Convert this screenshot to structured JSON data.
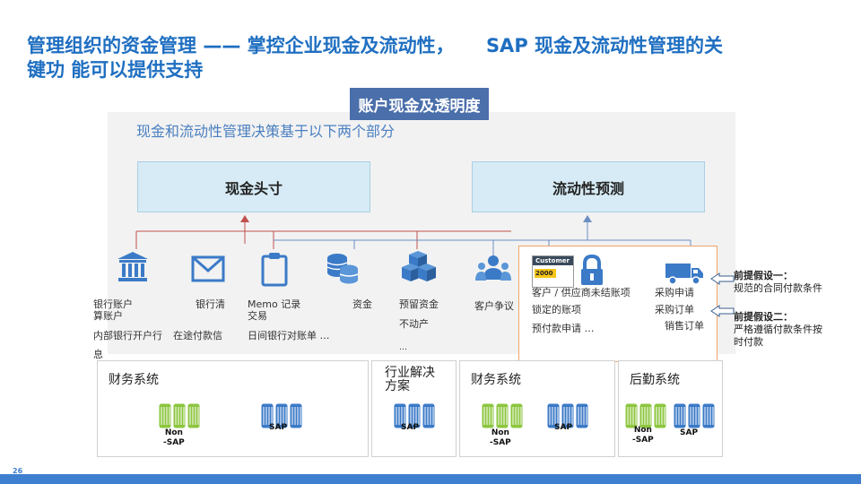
{
  "title": {
    "part1": "管理组织的资金管理",
    "part2": "—— 掌控企业现金及流动性，",
    "part3": "SAP  现金及流动性管理的关",
    "line2": "键功  能可以提供支持"
  },
  "header_box": "账户现金及透明度",
  "panel_caption": "现金和流动性管理决策基于以下两个部分",
  "boxes": {
    "cash_position": "现金头寸",
    "liquidity_forecast": "流动性预测"
  },
  "icons": {
    "bank": "bank-icon",
    "mail": "envelope-icon",
    "clipboard": "clipboard-icon",
    "coins": "coins-icon",
    "cubes": "cubes-icon",
    "people": "people-icon",
    "customer_card": "customer-card-icon",
    "lock": "lock-icon",
    "truck": "truck-icon",
    "arrow": "left-arrow-icon",
    "server": "server-icon"
  },
  "labels": {
    "bank_account": "银行账户",
    "calc_account": "算账户",
    "bank_clear": "银行清",
    "memo": "Memo  记录",
    "trade": "交易",
    "funds": "资金",
    "reserved_funds": "预留资金",
    "real_estate": "不动产",
    "dots_small": "…",
    "customer_dispute": "客户争议",
    "internal_bank": "内部银行开户行",
    "in_transit": "在途付款信",
    "info": "息",
    "daily_reconcile": "日间银行对账单  …",
    "customer_card_title": "Customer",
    "customer_card_num": "2000",
    "open_items": "客户 / 供应商未结账项",
    "locked_items": "锁定的账项",
    "prepayment": "预付款申请    …",
    "purchase_req": "采购申请",
    "purchase_order": "采购订单",
    "sales_order": "销售订单"
  },
  "assumptions": {
    "a1_title": "前提假设一：",
    "a1_text": "规范的合同付款条件",
    "a2_title": "前提假设二：",
    "a2_text1": "严格遵循付款条件按",
    "a2_text2": "时付款"
  },
  "systems": [
    {
      "title": "财务系统",
      "s1": "Non\n-SAP",
      "s2": "SAP"
    },
    {
      "title": "行业解决\n方案",
      "s1": "SAP"
    },
    {
      "title": "财务系统",
      "s1": "Non\n-SAP",
      "s2": "SAP"
    },
    {
      "title": "后勤系统",
      "s1": "Non\n-SAP",
      "s2": "SAP"
    }
  ],
  "page_number": "26",
  "colors": {
    "title": "#1f6fc1",
    "icon_blue": "#3b7ac7",
    "connector_red": "#c0504d",
    "server_green": "#8cc63f",
    "server_blue": "#3b7ac7",
    "footer": "#3f7fcf"
  }
}
